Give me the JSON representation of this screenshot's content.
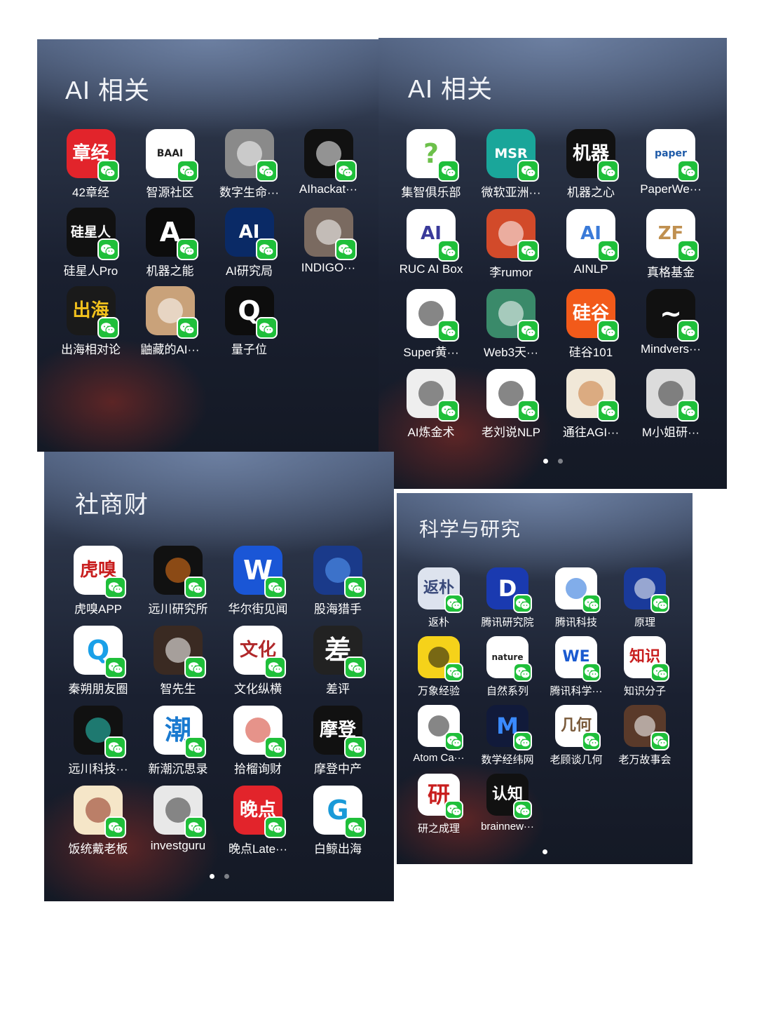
{
  "panels": [
    {
      "title": "AI 相关",
      "apps": [
        {
          "label": "42章经",
          "icon": "text-logo-icon",
          "glyph": "章经",
          "bg": "#e2242b",
          "fg": "#ffffff"
        },
        {
          "label": "智源社区",
          "icon": "baai-logo-icon",
          "glyph": "BAAI",
          "bg": "#ffffff",
          "fg": "#222222"
        },
        {
          "label": "数字生命···",
          "icon": "robot-avatar-icon",
          "glyph": "",
          "bg": "#8a8a8a",
          "fg": "#ffffff"
        },
        {
          "label": "AIhackat···",
          "icon": "striped-logo-icon",
          "glyph": "",
          "bg": "#111111",
          "fg": "#ffffff"
        },
        {
          "label": "硅星人Pro",
          "icon": "text-logo-icon",
          "glyph": "硅星人",
          "bg": "#111111",
          "fg": "#ffffff"
        },
        {
          "label": "机器之能",
          "icon": "a-logo-icon",
          "glyph": "A",
          "bg": "#0c0c0c",
          "fg": "#ffffff"
        },
        {
          "label": "AI研究局",
          "icon": "ai-logo-icon",
          "glyph": "AI",
          "bg": "#0a2a66",
          "fg": "#ffffff"
        },
        {
          "label": "INDIGO···",
          "icon": "photographer-avatar-icon",
          "glyph": "",
          "bg": "#7a6a60",
          "fg": "#ffffff"
        },
        {
          "label": "出海相对论",
          "icon": "text-logo-icon",
          "glyph": "出海",
          "bg": "#1a1a1a",
          "fg": "#f2c11d"
        },
        {
          "label": "鼬藏的AI···",
          "icon": "cat-avatar-icon",
          "glyph": "",
          "bg": "#c9a27a",
          "fg": "#ffffff"
        },
        {
          "label": "量子位",
          "icon": "q-logo-icon",
          "glyph": "Q",
          "bg": "#0d0d0d",
          "fg": "#ffffff"
        }
      ],
      "dots": 0
    },
    {
      "title": "AI 相关",
      "apps": [
        {
          "label": "集智俱乐部",
          "icon": "question-mark-logo-icon",
          "glyph": "?",
          "bg": "#ffffff",
          "fg": "#6cc04a"
        },
        {
          "label": "微软亚洲···",
          "icon": "microsoft-research-logo-icon",
          "glyph": "MSR",
          "bg": "#1aa69a",
          "fg": "#ffffff"
        },
        {
          "label": "机器之心",
          "icon": "robot-logo-icon",
          "glyph": "机器",
          "bg": "#111111",
          "fg": "#ffffff"
        },
        {
          "label": "PaperWe···",
          "icon": "paper-logo-icon",
          "glyph": "paper",
          "bg": "#ffffff",
          "fg": "#1e5aa8"
        },
        {
          "label": "RUC AI Box",
          "icon": "cube-logo-icon",
          "glyph": "AI",
          "bg": "#ffffff",
          "fg": "#3a3a9a"
        },
        {
          "label": "李rumor",
          "icon": "avatar-icon",
          "glyph": "",
          "bg": "#d24a2a",
          "fg": "#ffffff"
        },
        {
          "label": "AINLP",
          "icon": "robot-logo-icon",
          "glyph": "AI",
          "bg": "#ffffff",
          "fg": "#3a7ad8"
        },
        {
          "label": "真格基金",
          "icon": "zhenfund-logo-icon",
          "glyph": "ZF",
          "bg": "#ffffff",
          "fg": "#c09050"
        },
        {
          "label": "Super黄···",
          "icon": "cartoon-avatar-icon",
          "glyph": "",
          "bg": "#ffffff",
          "fg": "#222222"
        },
        {
          "label": "Web3天···",
          "icon": "landscape-icon",
          "glyph": "",
          "bg": "#3a8a6a",
          "fg": "#ffffff"
        },
        {
          "label": "硅谷101",
          "icon": "text-logo-icon",
          "glyph": "硅谷",
          "bg": "#f25a1a",
          "fg": "#ffffff"
        },
        {
          "label": "Mindvers···",
          "icon": "wave-logo-icon",
          "glyph": "~",
          "bg": "#111111",
          "fg": "#ffffff"
        },
        {
          "label": "AI炼金术",
          "icon": "sketch-avatar-icon",
          "glyph": "",
          "bg": "#eeeeee",
          "fg": "#333333"
        },
        {
          "label": "老刘说NLP",
          "icon": "cartoon-avatar-icon",
          "glyph": "",
          "bg": "#ffffff",
          "fg": "#222222"
        },
        {
          "label": "通往AGI···",
          "icon": "deer-avatar-icon",
          "glyph": "",
          "bg": "#f1e8d8",
          "fg": "#c8783a"
        },
        {
          "label": "M小姐研···",
          "icon": "avatar-icon",
          "glyph": "",
          "bg": "#dcdcdc",
          "fg": "#333333"
        }
      ],
      "dots": 2
    },
    {
      "title": "社商财",
      "apps": [
        {
          "label": "虎嗅APP",
          "icon": "text-logo-icon",
          "glyph": "虎嗅",
          "bg": "#ffffff",
          "fg": "#c81e1e"
        },
        {
          "label": "远川研究所",
          "icon": "bars-logo-icon",
          "glyph": "",
          "bg": "#111111",
          "fg": "#f07a1a"
        },
        {
          "label": "华尔街见闻",
          "icon": "w-logo-icon",
          "glyph": "W",
          "bg": "#1a56d6",
          "fg": "#ffffff"
        },
        {
          "label": "股海猎手",
          "icon": "data-grid-icon",
          "glyph": "",
          "bg": "#1a3a8a",
          "fg": "#5aa0ff"
        },
        {
          "label": "秦朔朋友圈",
          "icon": "ring-logo-icon",
          "glyph": "Q",
          "bg": "#ffffff",
          "fg": "#1aa0e8"
        },
        {
          "label": "智先生",
          "icon": "piano-photo-icon",
          "glyph": "",
          "bg": "#3a2a22",
          "fg": "#ffffff"
        },
        {
          "label": "文化纵横",
          "icon": "text-logo-icon",
          "glyph": "文化",
          "bg": "#ffffff",
          "fg": "#b0282a"
        },
        {
          "label": "差评",
          "icon": "text-logo-icon",
          "glyph": "差",
          "bg": "#222222",
          "fg": "#ffffff"
        },
        {
          "label": "远川科技···",
          "icon": "bars-logo-icon",
          "glyph": "",
          "bg": "#111111",
          "fg": "#2ad0c0"
        },
        {
          "label": "新潮沉思录",
          "icon": "wave-logo-icon",
          "glyph": "潮",
          "bg": "#ffffff",
          "fg": "#1a7ad0"
        },
        {
          "label": "拾榴询财",
          "icon": "pomegranate-icon",
          "glyph": "",
          "bg": "#ffffff",
          "fg": "#d23a2a"
        },
        {
          "label": "摩登中产",
          "icon": "text-logo-icon",
          "glyph": "摩登",
          "bg": "#111111",
          "fg": "#ffffff"
        },
        {
          "label": "饭统戴老板",
          "icon": "pattern-logo-icon",
          "glyph": "",
          "bg": "#f5e6c8",
          "fg": "#8a2a1a"
        },
        {
          "label": "investguru",
          "icon": "avatar-icon",
          "glyph": "",
          "bg": "#e8e8e8",
          "fg": "#333333"
        },
        {
          "label": "晚点Late···",
          "icon": "text-logo-icon",
          "glyph": "晚点",
          "bg": "#e2242b",
          "fg": "#ffffff"
        },
        {
          "label": "白鲸出海",
          "icon": "g-logo-icon",
          "glyph": "G",
          "bg": "#ffffff",
          "fg": "#1a9ad8"
        }
      ],
      "dots": 2
    },
    {
      "title": "科学与研究",
      "apps": [
        {
          "label": "返朴",
          "icon": "text-logo-icon",
          "glyph": "返朴",
          "bg": "#dde3ee",
          "fg": "#3a4a7a"
        },
        {
          "label": "腾讯研究院",
          "icon": "d-logo-icon",
          "glyph": "D",
          "bg": "#1a3ab0",
          "fg": "#ffffff"
        },
        {
          "label": "腾讯科技",
          "icon": "person-logo-icon",
          "glyph": "",
          "bg": "#ffffff",
          "fg": "#1a6ad8"
        },
        {
          "label": "原理",
          "icon": "telescope-logo-icon",
          "glyph": "",
          "bg": "#1a3a9a",
          "fg": "#ffffff"
        },
        {
          "label": "万象经验",
          "icon": "stripes-logo-icon",
          "glyph": "",
          "bg": "#f5d21a",
          "fg": "#111111"
        },
        {
          "label": "自然系列",
          "icon": "nature-logo-icon",
          "glyph": "nature",
          "bg": "#ffffff",
          "fg": "#222222"
        },
        {
          "label": "腾讯科学···",
          "icon": "we-logo-icon",
          "glyph": "WE",
          "bg": "#ffffff",
          "fg": "#1a5ad0"
        },
        {
          "label": "知识分子",
          "icon": "text-logo-icon",
          "glyph": "知识",
          "bg": "#ffffff",
          "fg": "#c81e1e"
        },
        {
          "label": "Atom Ca···",
          "icon": "spiral-logo-icon",
          "glyph": "",
          "bg": "#ffffff",
          "fg": "#222222"
        },
        {
          "label": "数学经纬网",
          "icon": "m-logo-icon",
          "glyph": "M",
          "bg": "#111a3a",
          "fg": "#3a8aff"
        },
        {
          "label": "老顾谈几何",
          "icon": "geometry-logo-icon",
          "glyph": "几何",
          "bg": "#ffffff",
          "fg": "#7a5a3a"
        },
        {
          "label": "老万故事会",
          "icon": "avatar-icon",
          "glyph": "",
          "bg": "#5a3a2a",
          "fg": "#ffffff"
        },
        {
          "label": "研之成理",
          "icon": "text-logo-icon",
          "glyph": "研",
          "bg": "#ffffff",
          "fg": "#c81e1e"
        },
        {
          "label": "brainnew···",
          "icon": "brain-logo-icon",
          "glyph": "认知",
          "bg": "#111111",
          "fg": "#ffffff"
        }
      ],
      "dots": 1
    }
  ]
}
